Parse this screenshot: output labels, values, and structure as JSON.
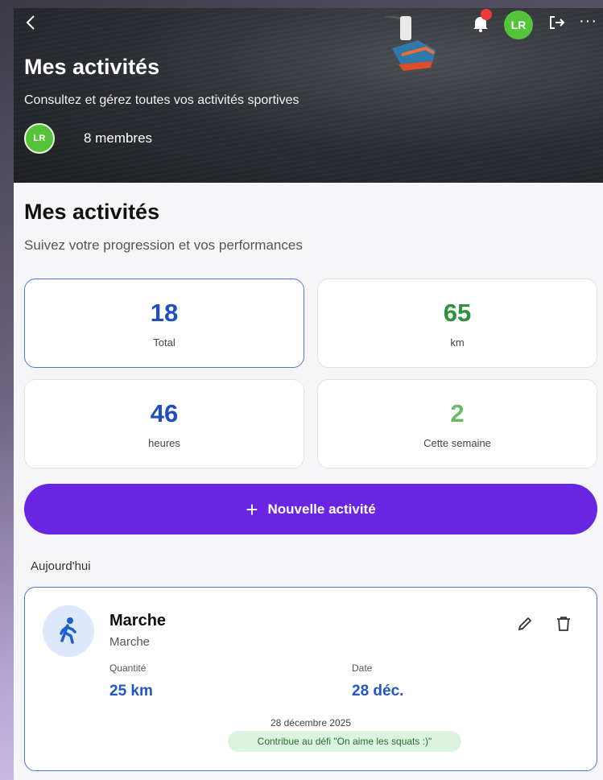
{
  "header": {
    "title": "Mes activités",
    "subtitle": "Consultez et gérez toutes vos activités sportives",
    "user_initials": "LR",
    "member_initials": "LR",
    "members_label": "8 membres",
    "more_label": "···"
  },
  "section": {
    "title": "Mes activités",
    "subtitle": "Suivez votre progression et vos performances"
  },
  "stats": [
    {
      "value": "18",
      "label": "Total",
      "color": "#1f4fbf"
    },
    {
      "value": "65",
      "label": "km",
      "color": "#2f8f3a"
    },
    {
      "value": "46",
      "label": "heures",
      "color": "#1f4fbf"
    },
    {
      "value": "2",
      "label": "Cette semaine",
      "color": "#6bb86b"
    }
  ],
  "new_activity": {
    "plus": "+",
    "label": "Nouvelle activité"
  },
  "day_label": "Aujourd'hui",
  "activity": {
    "title": "Marche",
    "type": "Marche",
    "quantity_label": "Quantité",
    "quantity_value": "25 km",
    "date_label": "Date",
    "date_value": "28 déc.",
    "full_date": "28 décembre 2025",
    "challenge": "Contribue au défi \"On aime les squats :)\""
  },
  "colors": {
    "primary_button": "#6a25e3",
    "accent_blue": "#2455c7",
    "avatar_green": "#55c43a",
    "notification_red": "#f03a3a"
  },
  "icons": [
    "back-icon",
    "bell-icon",
    "logout-icon",
    "more-icon",
    "walking-icon",
    "pencil-icon",
    "trash-icon",
    "plus-icon"
  ]
}
